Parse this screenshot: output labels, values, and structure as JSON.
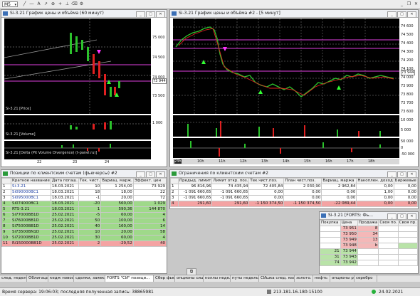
{
  "toolbar": {
    "timeframe": "M5"
  },
  "win1": {
    "title": "Si-3.21 График цены и объёма (60 минут)",
    "yticks": [
      "75 000",
      "74 500",
      "74 000",
      "73 500"
    ],
    "price_label": "Si-3.21 [Price]",
    "cur_price": "73 944",
    "vol_label": "Si-3.21 [Volume]",
    "vol_tick": "1 000",
    "delta_label": "Si-3.21 [Delta (Pit Volume Divergence) (t-panel.ru)]",
    "dates": [
      "22",
      "23",
      "24"
    ]
  },
  "win2": {
    "title": "Si-3.21 График цены и объёма #2 - [5 минут]",
    "yticks": [
      "74 600",
      "74 500",
      "74 400",
      "74 300",
      "74 200",
      "74 100",
      "74 000",
      "73 900",
      "73 800",
      "73 700",
      "73 600"
    ],
    "cur_price": "73 944",
    "vol_ticks": [
      "10 000",
      "5 000"
    ],
    "delta_ticks": [
      "50 000",
      "0",
      "-50 000"
    ],
    "dates": [
      "23h",
      "10h",
      "11h",
      "12h",
      "13h",
      "14h",
      "15h",
      "16h",
      "17h",
      "18h"
    ]
  },
  "positions": {
    "title": "Позиции по клиентским счетам (фьючерсы) #2",
    "headers": [
      "",
      "Краткое название",
      "Дата погаш.",
      "Тек. чист.",
      "Вариац. марж.",
      "Эффект. цен"
    ],
    "rows": [
      [
        "1",
        "Si-3.21",
        "18.03.2021",
        "10",
        "1 254,00",
        "73 929"
      ],
      [
        "2",
        "Si090000BC1",
        "18.03.2021",
        "18",
        "18,00",
        "22"
      ],
      [
        "3",
        "Si095000BC1",
        "18.03.2021",
        "-1",
        "20,00",
        "72"
      ],
      [
        "4",
        "Si074000BC1",
        "18.03.2021",
        "-20",
        "560,00",
        "1 029"
      ],
      [
        "5",
        "RTS-3.21",
        "18.03.2021",
        "1",
        "590,36",
        "144 870"
      ],
      [
        "6",
        "Si77000BB1D",
        "25.02.2021",
        "-5",
        "60,00",
        "4"
      ],
      [
        "7",
        "Si76000BB1D",
        "25.02.2021",
        "50",
        "100,00",
        "6"
      ],
      [
        "8",
        "Si75000BB1D",
        "25.02.2021",
        "40",
        "160,00",
        "14"
      ],
      [
        "9",
        "Si73500BN1D",
        "25.02.2021",
        "10",
        "20,00",
        "58"
      ],
      [
        "10",
        "Si72000BB1D",
        "25.02.2021",
        "30",
        "60,00",
        "4"
      ],
      [
        "11",
        "Ri150000BB1D",
        "25.02.2021",
        "2",
        "-29,52",
        "40"
      ]
    ]
  },
  "limits": {
    "title": "Ограничения по клиентским счетам #2",
    "headers": [
      "",
      "Предыд. лимит",
      "Лимит откр. поз.",
      "Тек.чист.поз.",
      "План чист.поз.",
      "Вариац. маржа",
      "Накоплен. доход",
      "Биржевые"
    ],
    "rows": [
      [
        "1",
        "96 816,96",
        "74 435,94",
        "72 405,84",
        "2 030,90",
        "2 962,84",
        "0,00",
        "0,00"
      ],
      [
        "2",
        "-1 091 660,65",
        "-1 091 660,65",
        "0,00",
        "0,00",
        "0,00",
        "1,00",
        "0,00"
      ],
      [
        "3",
        "-1 091 660,65",
        "-1 091 660,65",
        "0,00",
        "0,00",
        "0,00",
        "0,00",
        "0,00"
      ],
      [
        "4",
        "291,60",
        "291,60",
        "-1 150 374,50",
        "-1 150 374,50",
        "-22 089,44",
        "0,00",
        "0,00"
      ]
    ]
  },
  "dom": {
    "title": "Si-3.21 [FORTS: Фь...",
    "headers": [
      "Покупка",
      "Цена",
      "Продажа",
      "Своя по.",
      "Своя пр."
    ],
    "rows": [
      [
        "",
        "73 951",
        "8",
        "",
        ""
      ],
      [
        "",
        "73 950",
        "34",
        "",
        ""
      ],
      [
        "",
        "73 949",
        "13",
        "",
        ""
      ],
      [
        "",
        "73 948",
        "b",
        "",
        ""
      ],
      [
        "21",
        "73 944",
        "",
        "",
        ""
      ],
      [
        "31",
        "73 943",
        "",
        "",
        ""
      ],
      [
        "74",
        "73 942",
        "",
        "",
        ""
      ]
    ]
  },
  "tabs": [
    "след. неделя",
    "Облигации",
    "кедж новости",
    "сделки, заявка",
    "FORTS \"СИ\" позици...",
    "Сбер фьюч",
    "опционы сишка",
    "коллы неделя",
    "путы неделька",
    "СИшка след. квартал",
    "золото.",
    "нефть",
    "опционы ртс",
    "серебро"
  ],
  "status": {
    "server": "Время сервера: 19:06:03; последняя полученная запись: 38865981",
    "ip": "213.181.16.180:15100",
    "date": "24.02.2021"
  }
}
